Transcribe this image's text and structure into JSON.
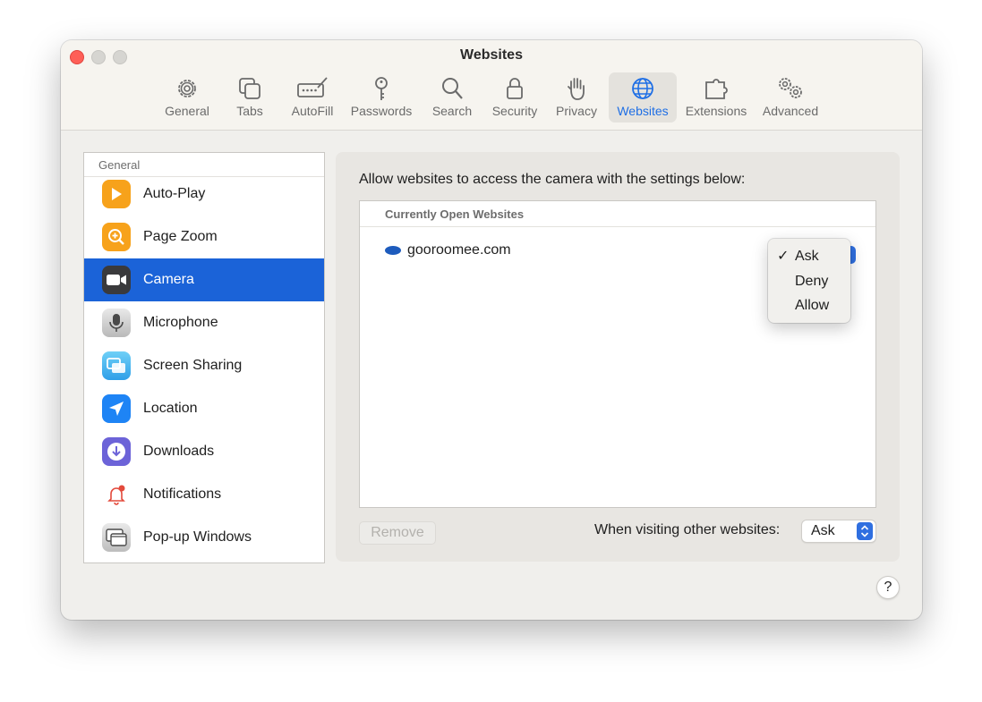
{
  "window": {
    "title": "Websites"
  },
  "toolbar": {
    "items": [
      {
        "label": "General",
        "icon": "gear-icon"
      },
      {
        "label": "Tabs",
        "icon": "tabs-icon"
      },
      {
        "label": "AutoFill",
        "icon": "autofill-icon"
      },
      {
        "label": "Passwords",
        "icon": "key-icon"
      },
      {
        "label": "Search",
        "icon": "magnifier-icon"
      },
      {
        "label": "Security",
        "icon": "lock-icon"
      },
      {
        "label": "Privacy",
        "icon": "hand-icon"
      },
      {
        "label": "Websites",
        "icon": "globe-icon",
        "selected": true
      },
      {
        "label": "Extensions",
        "icon": "puzzle-icon"
      },
      {
        "label": "Advanced",
        "icon": "gears-icon"
      }
    ]
  },
  "sidebar": {
    "header": "General",
    "items": [
      {
        "label": "Auto-Play",
        "icon": "play-icon"
      },
      {
        "label": "Page Zoom",
        "icon": "zoom-icon"
      },
      {
        "label": "Camera",
        "icon": "camera-icon",
        "selected": true
      },
      {
        "label": "Microphone",
        "icon": "microphone-icon"
      },
      {
        "label": "Screen Sharing",
        "icon": "screen-sharing-icon"
      },
      {
        "label": "Location",
        "icon": "location-icon"
      },
      {
        "label": "Downloads",
        "icon": "download-icon"
      },
      {
        "label": "Notifications",
        "icon": "bell-icon"
      },
      {
        "label": "Pop-up Windows",
        "icon": "popup-window-icon"
      }
    ]
  },
  "panel": {
    "description": "Allow websites to access the camera with the settings below:",
    "sites_header": "Currently Open Websites",
    "sites": [
      {
        "name": "gooroomee.com",
        "setting": "Ask"
      }
    ],
    "popup_menu": {
      "options": [
        "Ask",
        "Deny",
        "Allow"
      ],
      "checked": "Ask",
      "check_mark": "✓"
    },
    "remove_label": "Remove",
    "other_label": "When visiting other websites:",
    "other_value": "Ask"
  },
  "help_label": "?",
  "colors": {
    "accent": "#1b63d8",
    "close": "#fe5f57"
  }
}
